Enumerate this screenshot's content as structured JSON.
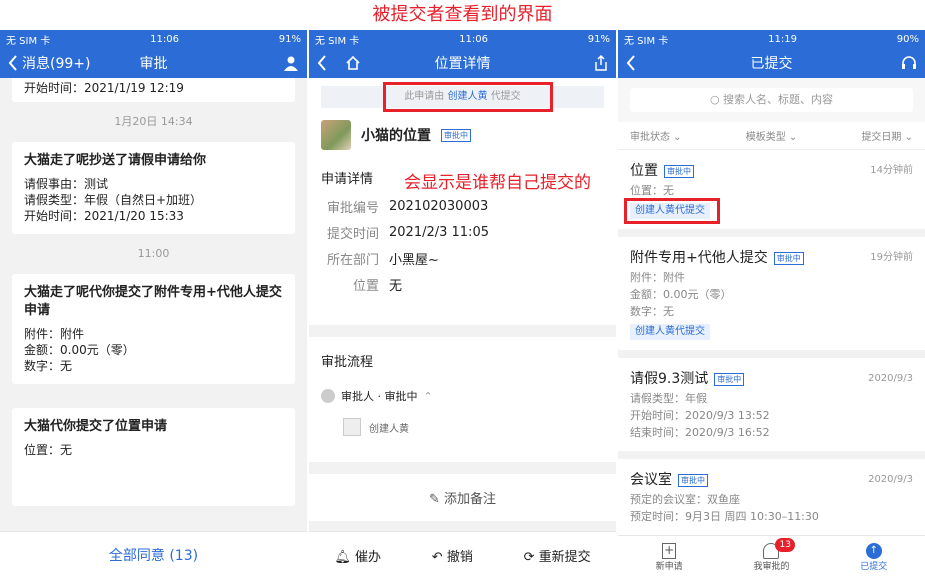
{
  "caption": "被提交者查看到的界面",
  "annotation": "会显示是谁帮自己提交的",
  "status": {
    "p1": {
      "carrier": "无 SIM 卡",
      "time": "11:06",
      "battery": "91%"
    },
    "p2": {
      "carrier": "无 SIM 卡",
      "time": "11:06",
      "battery": "91%"
    },
    "p3": {
      "carrier": "无 SIM 卡",
      "time": "11:19",
      "battery": "90%"
    }
  },
  "p1": {
    "back": "消息(99+)",
    "title": "审批",
    "top_line": "开始时间：2021/1/19 12:19",
    "ts1": "1月20日 14:34",
    "card1": {
      "title": "大猫走了呢抄送了请假申请给你",
      "l1": "请假事由：测试",
      "l2": "请假类型：年假（自然日+加班）",
      "l3": "开始时间：2021/1/20 15:33"
    },
    "ts2": "11:00",
    "card2": {
      "title": "大猫走了呢代你提交了附件专用+代他人提交申请",
      "l1": "附件：附件",
      "l2": "金额：0.00元（零）",
      "l3": "数字：无"
    },
    "card3": {
      "title": "大猫代你提交了位置申请",
      "l1": "位置：无"
    },
    "bottom": "全部同意 (13)"
  },
  "p2": {
    "title": "位置详情",
    "banner_prefix": "此申请由",
    "banner_name": "创建人黄",
    "banner_suffix": "代提交",
    "name": "小猫的位置",
    "tag": "审批中",
    "section": "申请详情",
    "rows": [
      {
        "k": "审批编号",
        "v": "202102030003"
      },
      {
        "k": "提交时间",
        "v": "2021/2/3 11:05"
      },
      {
        "k": "所在部门",
        "v": "小黑屋~"
      },
      {
        "k": "位置",
        "v": "无"
      }
    ],
    "flow": "审批流程",
    "approver": "审批人 · 审批中",
    "creator": "创建人黄",
    "note": "添加备注",
    "btn1": "催办",
    "btn2": "撤销",
    "btn3": "重新提交"
  },
  "p3": {
    "title": "已提交",
    "search": "搜索人名、标题、内容",
    "filters": [
      "审批状态",
      "模板类型",
      "提交日期"
    ],
    "items": [
      {
        "title": "位置",
        "tag": "审批中",
        "time": "14分钟前",
        "lines": [
          "位置：无"
        ],
        "badge": "创建人黄代提交"
      },
      {
        "title": "附件专用+代他人提交",
        "tag": "审批中",
        "time": "19分钟前",
        "lines": [
          "附件：附件",
          "金额：0.00元（零）",
          "数字：无"
        ],
        "badge": "创建人黄代提交"
      },
      {
        "title": "请假9.3测试",
        "tag": "审批中",
        "time": "2020/9/3",
        "lines": [
          "请假类型：年假",
          "开始时间：2020/9/3 13:52",
          "结束时间：2020/9/3 16:52"
        ],
        "badge": ""
      },
      {
        "title": "会议室",
        "tag": "审批中",
        "time": "2020/9/3",
        "lines": [
          "预定的会议室：双鱼座",
          "预定时间：9月3日 周四 10:30–11:30"
        ],
        "badge": ""
      }
    ],
    "tabs": [
      {
        "label": "新申请"
      },
      {
        "label": "我审批的",
        "count": "13"
      },
      {
        "label": "已提交"
      }
    ]
  }
}
